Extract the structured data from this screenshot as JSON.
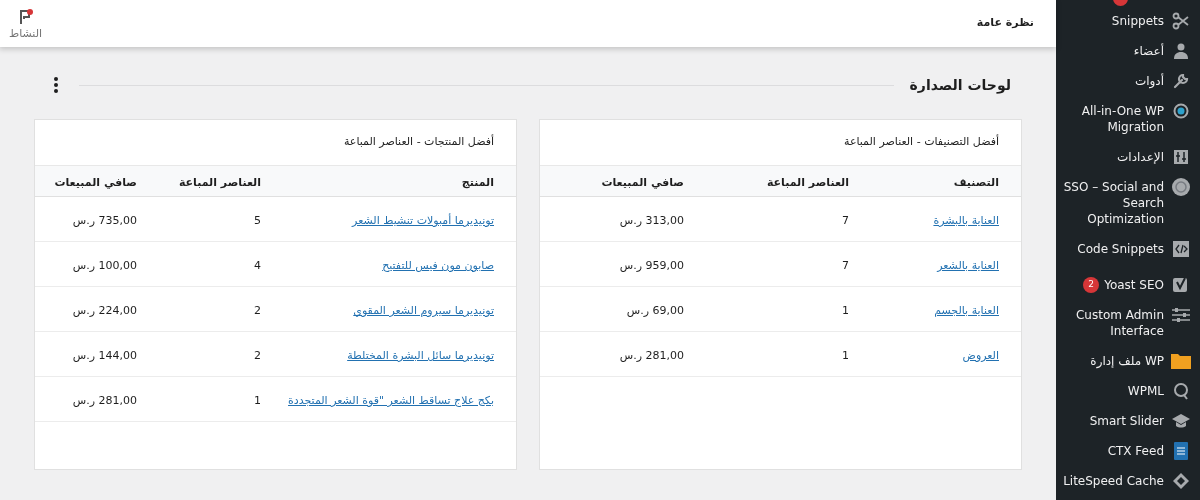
{
  "header": {
    "title": "نظرة عامة",
    "activity_label": "النشاط"
  },
  "section": {
    "title": "لوحات الصدارة"
  },
  "cards": [
    {
      "title": "أفضل التصنيفات - العناصر المباعة",
      "columns": [
        "التصنيف",
        "العناصر المباعة",
        "صافي المبيعات"
      ],
      "rows": [
        {
          "cells": [
            "العناية بالبشرة",
            "7",
            "313,00 ر.س"
          ]
        },
        {
          "cells": [
            "العناية بالشعر",
            "7",
            "959,00 ر.س"
          ]
        },
        {
          "cells": [
            "العناية بالجسم",
            "1",
            "69,00 ر.س"
          ]
        },
        {
          "cells": [
            "العروض",
            "1",
            "281,00 ر.س"
          ]
        }
      ]
    },
    {
      "title": "أفضل المنتجات - العناصر المباعة",
      "columns": [
        "المنتج",
        "العناصر المباعة",
        "صافي المبيعات"
      ],
      "rows": [
        {
          "cells": [
            "تونيديرما أمبولات تنشيط الشعر",
            "5",
            "735,00 ر.س"
          ]
        },
        {
          "cells": [
            "صابون مون فيس للتفتيح",
            "4",
            "100,00 ر.س"
          ]
        },
        {
          "cells": [
            "تونيديرما سيروم الشعر المقوي",
            "2",
            "224,00 ر.س"
          ]
        },
        {
          "cells": [
            "تونيديرما سائل البشرة المختلطة",
            "2",
            "144,00 ر.س"
          ]
        },
        {
          "cells": [
            "بكج علاج تساقط الشعر \"قوة الشعر المتجددة",
            "1",
            "281,00 ر.س"
          ]
        }
      ]
    }
  ],
  "sidebar": {
    "items": [
      {
        "label": "Snippets"
      },
      {
        "label": "أعضاء"
      },
      {
        "label": "أدوات"
      },
      {
        "label": "All-in-One WP Migration"
      },
      {
        "label": "الإعدادات"
      },
      {
        "label": "SSO – Social and Search Optimization"
      },
      {
        "label": "Code Snippets"
      },
      {
        "label": "Yoast SEO",
        "badge": "2"
      },
      {
        "label": "Custom Admin Interface"
      },
      {
        "label": "ملف إدارة WP"
      },
      {
        "label": "WPML"
      },
      {
        "label": "Smart Slider"
      },
      {
        "label": "CTX Feed"
      },
      {
        "label": "LiteSpeed Cache"
      }
    ]
  }
}
